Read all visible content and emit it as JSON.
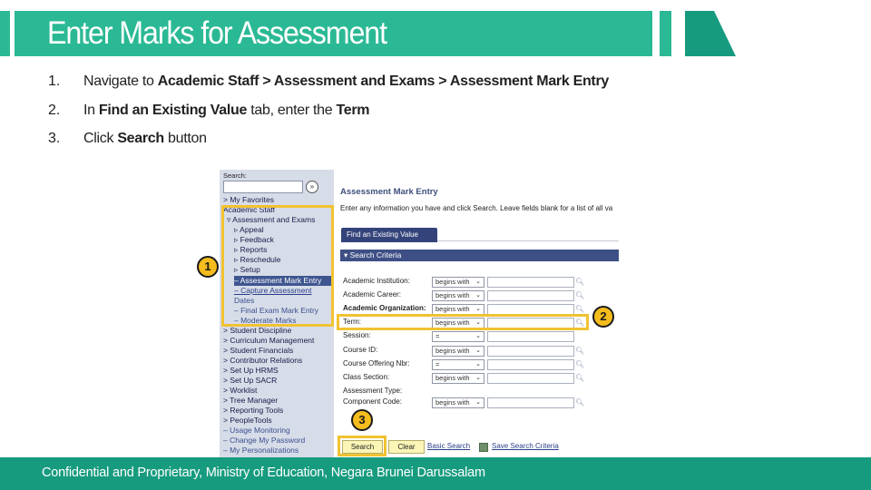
{
  "header": {
    "title": "Enter Marks for Assessment",
    "color": "#2bb995",
    "accent_dark": "#179b7f"
  },
  "steps": [
    {
      "num": "1.",
      "parts": [
        {
          "text": "Navigate to ",
          "bold": false
        },
        {
          "text": "Academic Staff > Assessment and Exams > Assessment Mark Entry",
          "bold": true
        }
      ]
    },
    {
      "num": "2.",
      "parts": [
        {
          "text": "In ",
          "bold": false
        },
        {
          "text": "Find an Existing Value",
          "bold": true
        },
        {
          "text": " tab, enter the ",
          "bold": false
        },
        {
          "text": "Term",
          "bold": true
        }
      ]
    },
    {
      "num": "3.",
      "parts": [
        {
          "text": "Click ",
          "bold": false
        },
        {
          "text": "Search",
          "bold": true
        },
        {
          "text": " button",
          "bold": false
        }
      ]
    }
  ],
  "sidebar": {
    "search_label": "Search:",
    "search_value": "",
    "go_icon": "double-chevron-right-icon",
    "items": [
      {
        "label": "> My Favorites",
        "level": 0,
        "style": "normal"
      },
      {
        "label": "Academic Staff",
        "level": 0,
        "style": "normal"
      },
      {
        "label": "▿ Assessment and Exams",
        "level": 1,
        "style": "normal"
      },
      {
        "label": "▹ Appeal",
        "level": 2,
        "style": "normal"
      },
      {
        "label": "▹ Feedback",
        "level": 2,
        "style": "normal"
      },
      {
        "label": "▹ Reports",
        "level": 2,
        "style": "normal"
      },
      {
        "label": "▹ Reschedule",
        "level": 2,
        "style": "normal"
      },
      {
        "label": "▹ Setup",
        "level": 2,
        "style": "normal"
      },
      {
        "label": "– Assessment Mark Entry",
        "level": 2,
        "style": "selected"
      },
      {
        "label": "– Capture Assessment",
        "level": 2,
        "style": "link"
      },
      {
        "label": "  Dates",
        "level": 2,
        "style": "gray"
      },
      {
        "label": "– Final Exam Mark Entry",
        "level": 2,
        "style": "gray"
      },
      {
        "label": "– Moderate Marks",
        "level": 2,
        "style": "gray"
      },
      {
        "label": "> Student Discipline",
        "level": 0,
        "style": "normal"
      },
      {
        "label": "> Curriculum Management",
        "level": 0,
        "style": "normal"
      },
      {
        "label": "> Student Financials",
        "level": 0,
        "style": "normal"
      },
      {
        "label": "> Contributor Relations",
        "level": 0,
        "style": "normal"
      },
      {
        "label": "> Set Up HRMS",
        "level": 0,
        "style": "normal"
      },
      {
        "label": "> Set Up SACR",
        "level": 0,
        "style": "normal"
      },
      {
        "label": "> Worklist",
        "level": 0,
        "style": "normal"
      },
      {
        "label": "> Tree Manager",
        "level": 0,
        "style": "normal"
      },
      {
        "label": "> Reporting Tools",
        "level": 0,
        "style": "normal"
      },
      {
        "label": "> PeopleTools",
        "level": 0,
        "style": "normal"
      },
      {
        "label": "– Usage Monitoring",
        "level": 0,
        "style": "gray"
      },
      {
        "label": "– Change My Password",
        "level": 0,
        "style": "gray"
      },
      {
        "label": "– My Personalizations",
        "level": 0,
        "style": "gray"
      }
    ]
  },
  "main": {
    "title": "Assessment Mark Entry",
    "instructions": "Enter any information you have and click Search. Leave fields blank for a list of all va",
    "tab_label": "Find an Existing Value",
    "section_label": "▾ Search Criteria",
    "fields": [
      {
        "label": "Academic Institution:",
        "operator": "begins with",
        "value": "",
        "bold": false,
        "lookup": true
      },
      {
        "label": "Academic Career:",
        "operator": "begins with",
        "value": "",
        "bold": false,
        "lookup": true
      },
      {
        "label": "Academic Organization:",
        "operator": "begins with",
        "value": "",
        "bold": true,
        "lookup": true
      },
      {
        "label": "Term:",
        "operator": "begins with",
        "value": "",
        "bold": false,
        "lookup": true
      },
      {
        "label": "Session:",
        "operator": "=",
        "value": "",
        "bold": false,
        "lookup": false
      },
      {
        "label": "Course ID:",
        "operator": "begins with",
        "value": "",
        "bold": false,
        "lookup": true
      },
      {
        "label": "Course Offering Nbr:",
        "operator": "=",
        "value": "",
        "bold": false,
        "lookup": true
      },
      {
        "label": "Class Section:",
        "operator": "begins with",
        "value": "",
        "bold": false,
        "lookup": true
      },
      {
        "label": "Assessment Type:",
        "operator": null,
        "value": null,
        "bold": false,
        "lookup": false
      },
      {
        "label": "Component Code:",
        "operator": "begins with",
        "value": "",
        "bold": false,
        "lookup": true
      }
    ],
    "search_button": "Search",
    "clear_button": "Clear",
    "basic_search_link": "Basic Search",
    "save_criteria_link": "Save Search Criteria"
  },
  "callouts": {
    "one": "1",
    "two": "2",
    "three": "3",
    "highlight_color": "#f1c232",
    "badge_color": "#f4bc1c"
  },
  "footer": {
    "text": "Confidential and Proprietary, Ministry of Education, Negara Brunei Darussalam"
  }
}
